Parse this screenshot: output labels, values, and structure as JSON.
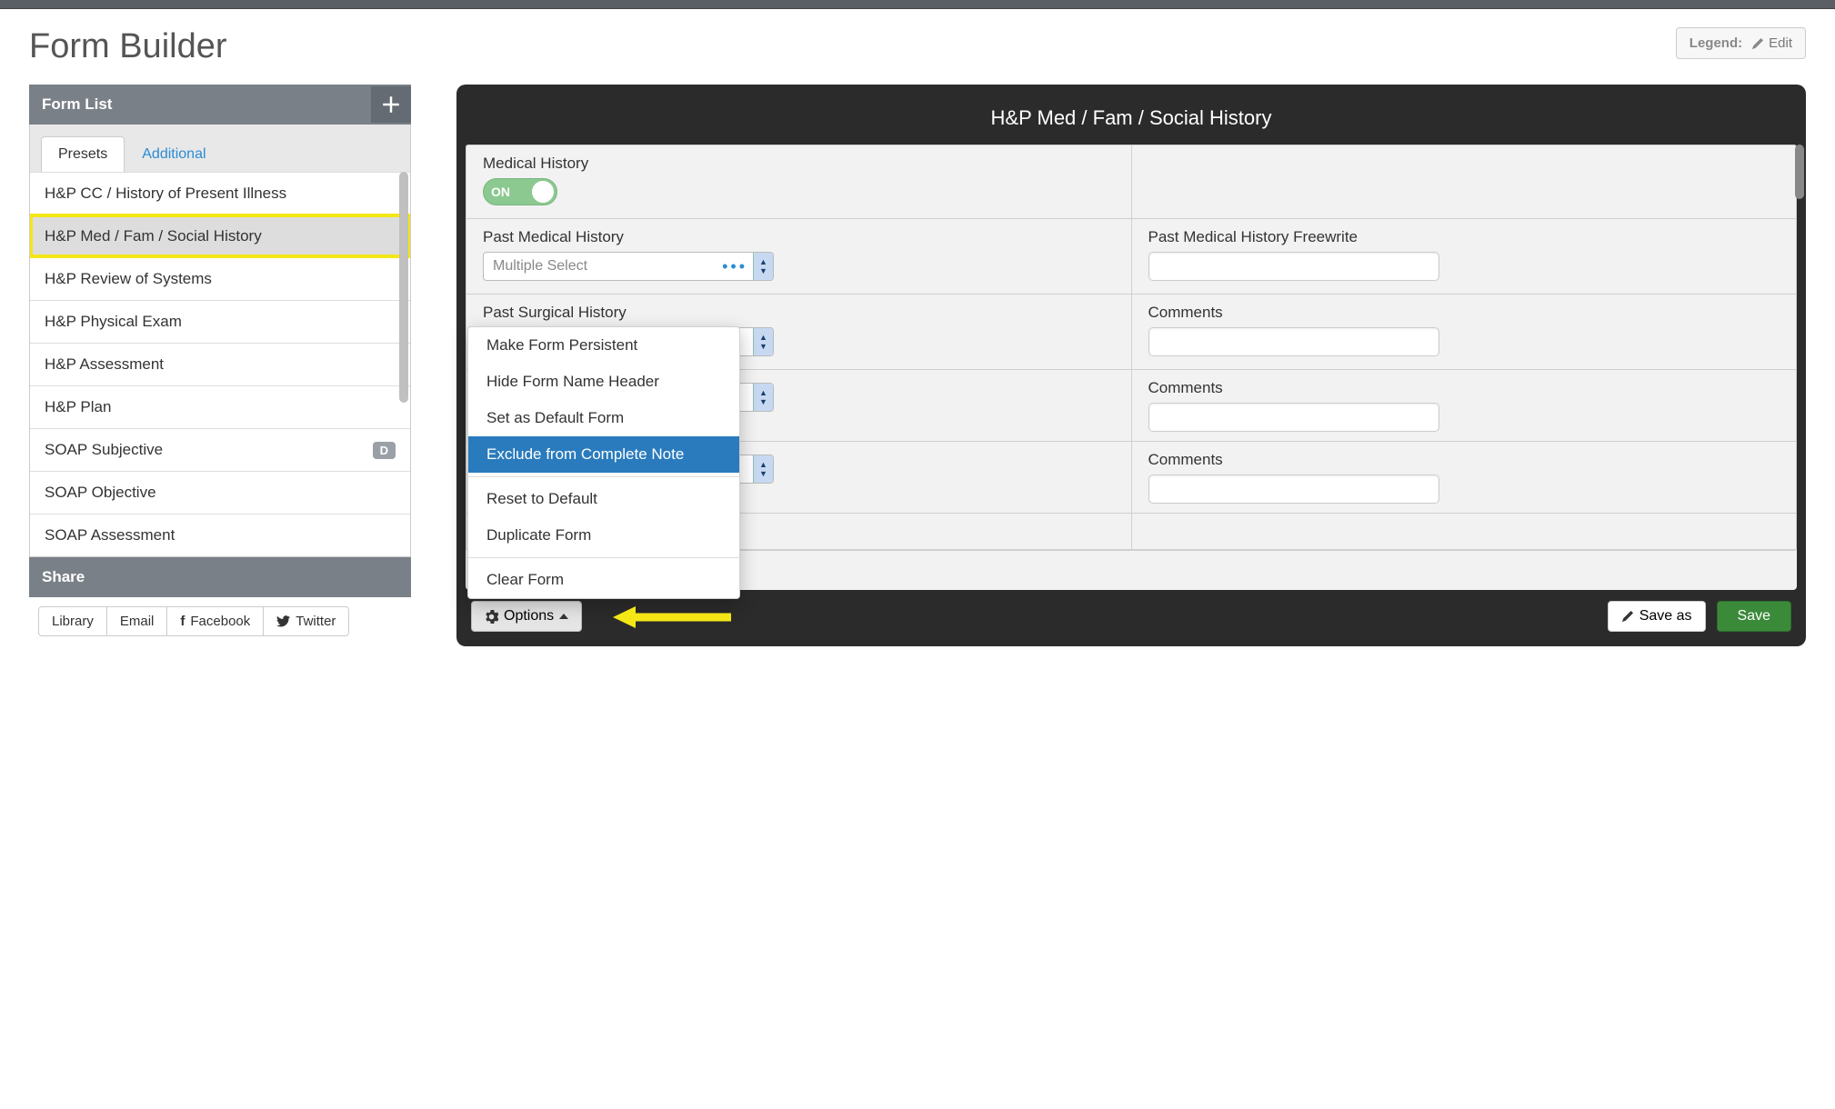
{
  "page_title": "Form Builder",
  "legend": {
    "label": "Legend:",
    "edit": "Edit"
  },
  "form_list": {
    "title": "Form List",
    "tabs": [
      {
        "label": "Presets",
        "active": true
      },
      {
        "label": "Additional",
        "active": false
      }
    ],
    "items": [
      {
        "label": "H&P CC / History of Present Illness"
      },
      {
        "label": "H&P Med / Fam / Social History",
        "selected": true
      },
      {
        "label": "H&P Review of Systems"
      },
      {
        "label": "H&P Physical Exam"
      },
      {
        "label": "H&P Assessment"
      },
      {
        "label": "H&P Plan"
      },
      {
        "label": "SOAP Subjective",
        "badge": "D"
      },
      {
        "label": "SOAP Objective"
      },
      {
        "label": "SOAP Assessment"
      }
    ]
  },
  "share": {
    "title": "Share",
    "buttons": [
      {
        "label": "Library"
      },
      {
        "label": "Email"
      },
      {
        "label": "Facebook",
        "icon": "facebook"
      },
      {
        "label": "Twitter",
        "icon": "twitter"
      }
    ]
  },
  "form": {
    "title": "H&P Med / Fam / Social History",
    "sections": {
      "medical_history": {
        "label": "Medical History",
        "toggle": "ON"
      },
      "past_medical": {
        "label": "Past Medical History",
        "select": "Multiple Select",
        "freewrite_label": "Past Medical History Freewrite"
      },
      "past_surgical": {
        "label": "Past Surgical History",
        "comments_label": "Comments"
      },
      "row3": {
        "comments_label": "Comments"
      },
      "row4": {
        "comments_label": "Comments"
      }
    }
  },
  "options_menu": {
    "items": [
      "Make Form Persistent",
      "Hide Form Name Header",
      "Set as Default Form",
      "Exclude from Complete Note",
      "Reset to Default",
      "Duplicate Form",
      "Clear Form"
    ],
    "highlighted": "Exclude from Complete Note"
  },
  "footer": {
    "options": "Options",
    "save_as": "Save as",
    "save": "Save"
  }
}
